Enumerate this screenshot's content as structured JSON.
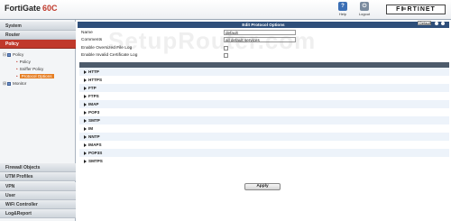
{
  "header": {
    "brand_name": "FortiGate",
    "brand_model": "60C",
    "help_label": "Help",
    "logout_label": "Logout",
    "logo_text": "F⊫RTINET"
  },
  "sidebar": {
    "top_sections": [
      "System",
      "Router",
      "Policy"
    ],
    "tree": {
      "policy": "Policy",
      "policy_child": "Policy",
      "sniffer": "Sniffer Policy",
      "protocol": "Protocol Options",
      "monitor": "Monitor"
    },
    "bottom_sections": [
      "Firewall Objects",
      "UTM Profiles",
      "VPN",
      "User",
      "WiFi Controller",
      "Log&Report"
    ]
  },
  "panel": {
    "title": "Edit Protocol Options",
    "vdom_value": "Default",
    "name_label": "Name",
    "name_value": "default",
    "comments_label": "Comments",
    "comments_value": "all default services",
    "oversized_label": "Enable Oversized File Log",
    "invalid_cert_label": "Enable Invalid Certificate Log",
    "protocols": [
      "HTTP",
      "HTTPS",
      "FTP",
      "FTPS",
      "IMAP",
      "POP3",
      "SMTP",
      "IM",
      "NNTP",
      "IMAPS",
      "POP3S",
      "SMTPS"
    ],
    "apply_label": "Apply"
  },
  "watermark": "SetupRouter.com",
  "colors": {
    "accent_red": "#c0392b",
    "titlebar": "#2f4f7a",
    "selected_item": "#e67e22"
  }
}
